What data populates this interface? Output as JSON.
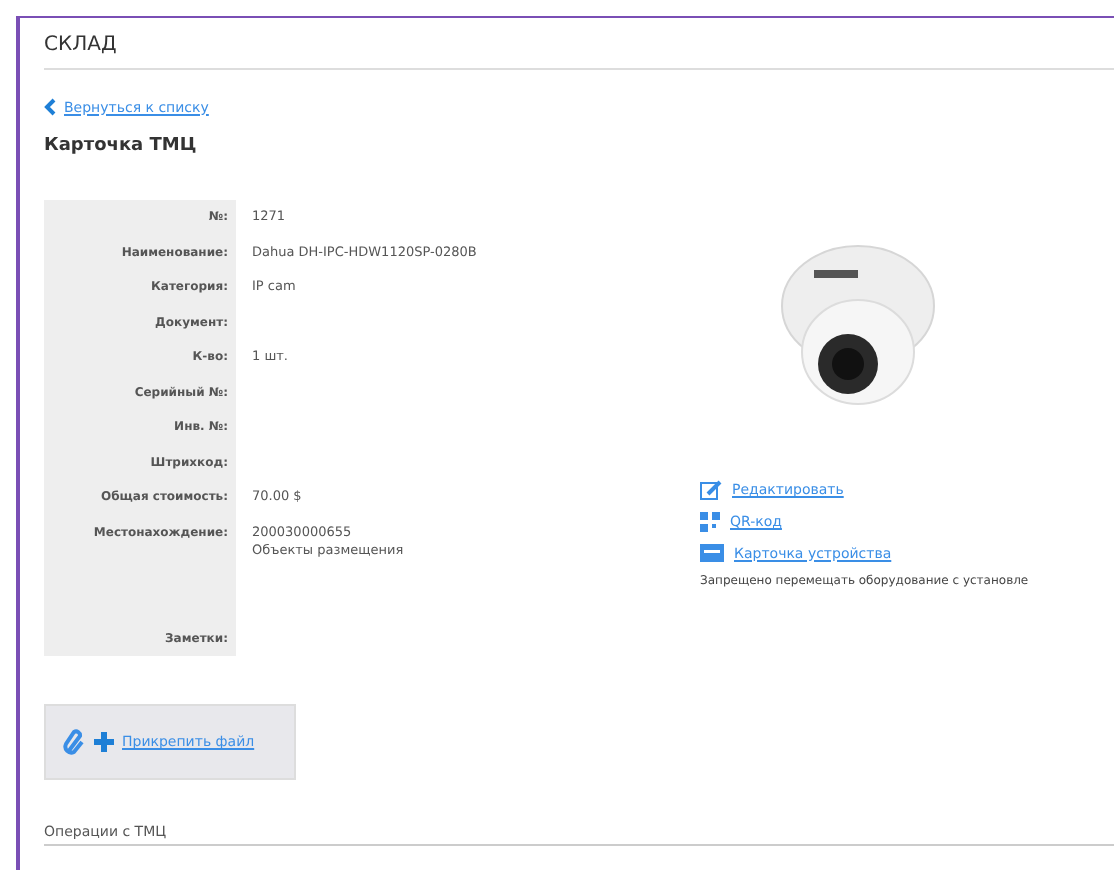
{
  "header": {
    "title": "СКЛАД"
  },
  "back_link": "Вернуться к списку",
  "page_title": "Карточка ТМЦ",
  "fields": [
    {
      "label": "№:",
      "value": [
        "1271"
      ]
    },
    {
      "label": "Наименование:",
      "value": [
        "Dahua DH-IPC-HDW1120SP-0280B"
      ]
    },
    {
      "label": "Категория:",
      "value": [
        "IP cam"
      ]
    },
    {
      "label": "Документ:"
    },
    {
      "label": "К-во:",
      "value": [
        "1 шт."
      ]
    },
    {
      "label": "Серийный №:"
    },
    {
      "label": "Инв. №:"
    },
    {
      "label": "Штрихкод:"
    },
    {
      "label": "Общая стоимость:",
      "value": [
        "70.00 $"
      ]
    },
    {
      "label": "Местонахождение:",
      "value": [
        "200030000655",
        "Объекты размещения"
      ]
    },
    {
      "label": "Заметки:"
    }
  ],
  "actions": [
    {
      "kind": "edit",
      "label": "Редактировать"
    },
    {
      "kind": "qr",
      "label": "QR-код"
    },
    {
      "kind": "card",
      "label": "Карточка устройства"
    }
  ],
  "note": "Запрещено перемещать оборудование с установле",
  "attach_button": "Прикрепить файл",
  "section_title": "Операции с ТМЦ"
}
